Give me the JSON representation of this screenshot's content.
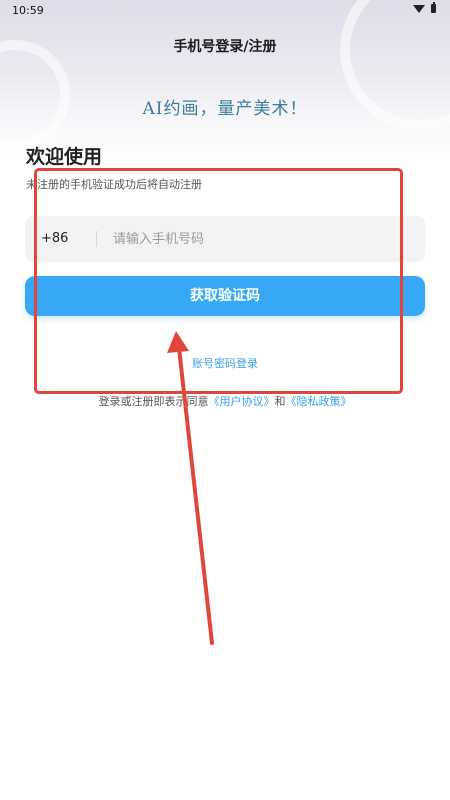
{
  "status_bar": {
    "time": "10:59"
  },
  "header": {
    "title": "手机号登录/注册"
  },
  "slogan": "AI约画，量产美术！",
  "welcome": {
    "title": "欢迎使用",
    "subtitle": "未注册的手机验证成功后将自动注册"
  },
  "phone_field": {
    "country_code": "+86",
    "placeholder": "请输入手机号码",
    "value": ""
  },
  "get_code_button": {
    "label": "获取验证码"
  },
  "password_login": {
    "label": "账号密码登录"
  },
  "agreement": {
    "prefix": "登录或注册即表示同意",
    "user_agreement": "《用户协议》",
    "conjunction": "和",
    "privacy_policy": "《隐私政策》"
  },
  "colors": {
    "accent": "#36a8f5",
    "link": "#3aa0e8",
    "annotation": "#e0463a",
    "slogan": "#3a7f9c"
  },
  "icons": [
    "wifi-icon",
    "battery-icon"
  ]
}
